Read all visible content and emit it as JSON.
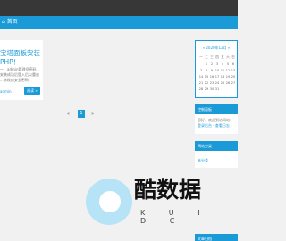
{
  "nav": {
    "first_item": "⌂ 首页"
  },
  "post": {
    "title": "宝塔面板安装 PHP！",
    "excerpt": "一、admin管理员密码\n。安装成功后登入后以重启 ...修改成安全密码！",
    "author": "admin",
    "read_more": "阅读 »"
  },
  "pagination": {
    "prev": "«",
    "current": "1",
    "next": "»"
  },
  "calendar": {
    "title": "« 2020年12月 »",
    "weekdays": [
      "一",
      "二",
      "三",
      "四",
      "五",
      "六",
      "日"
    ],
    "weeks": [
      [
        "",
        "1",
        "2",
        "3",
        "4",
        "5",
        "6"
      ],
      [
        "7",
        "8",
        "9",
        "10",
        "11",
        "12",
        "13"
      ],
      [
        "14",
        "15",
        "16",
        "17",
        "18",
        "19",
        "20"
      ],
      [
        "21",
        "22",
        "23",
        "24",
        "25",
        "26",
        "27"
      ],
      [
        "28",
        "29",
        "30",
        "31",
        "",
        "",
        ""
      ]
    ]
  },
  "widgets": {
    "w1_title": "控制面板",
    "w1_line1": "您好，欢迎到访网站！",
    "w1_links": "登录后台 · 查看日志",
    "w2_title": "网站分类",
    "w2_item": "未分类",
    "w3_title": "文章归档"
  },
  "watermark": {
    "cn": "酷数据",
    "en": "K U I D C"
  }
}
